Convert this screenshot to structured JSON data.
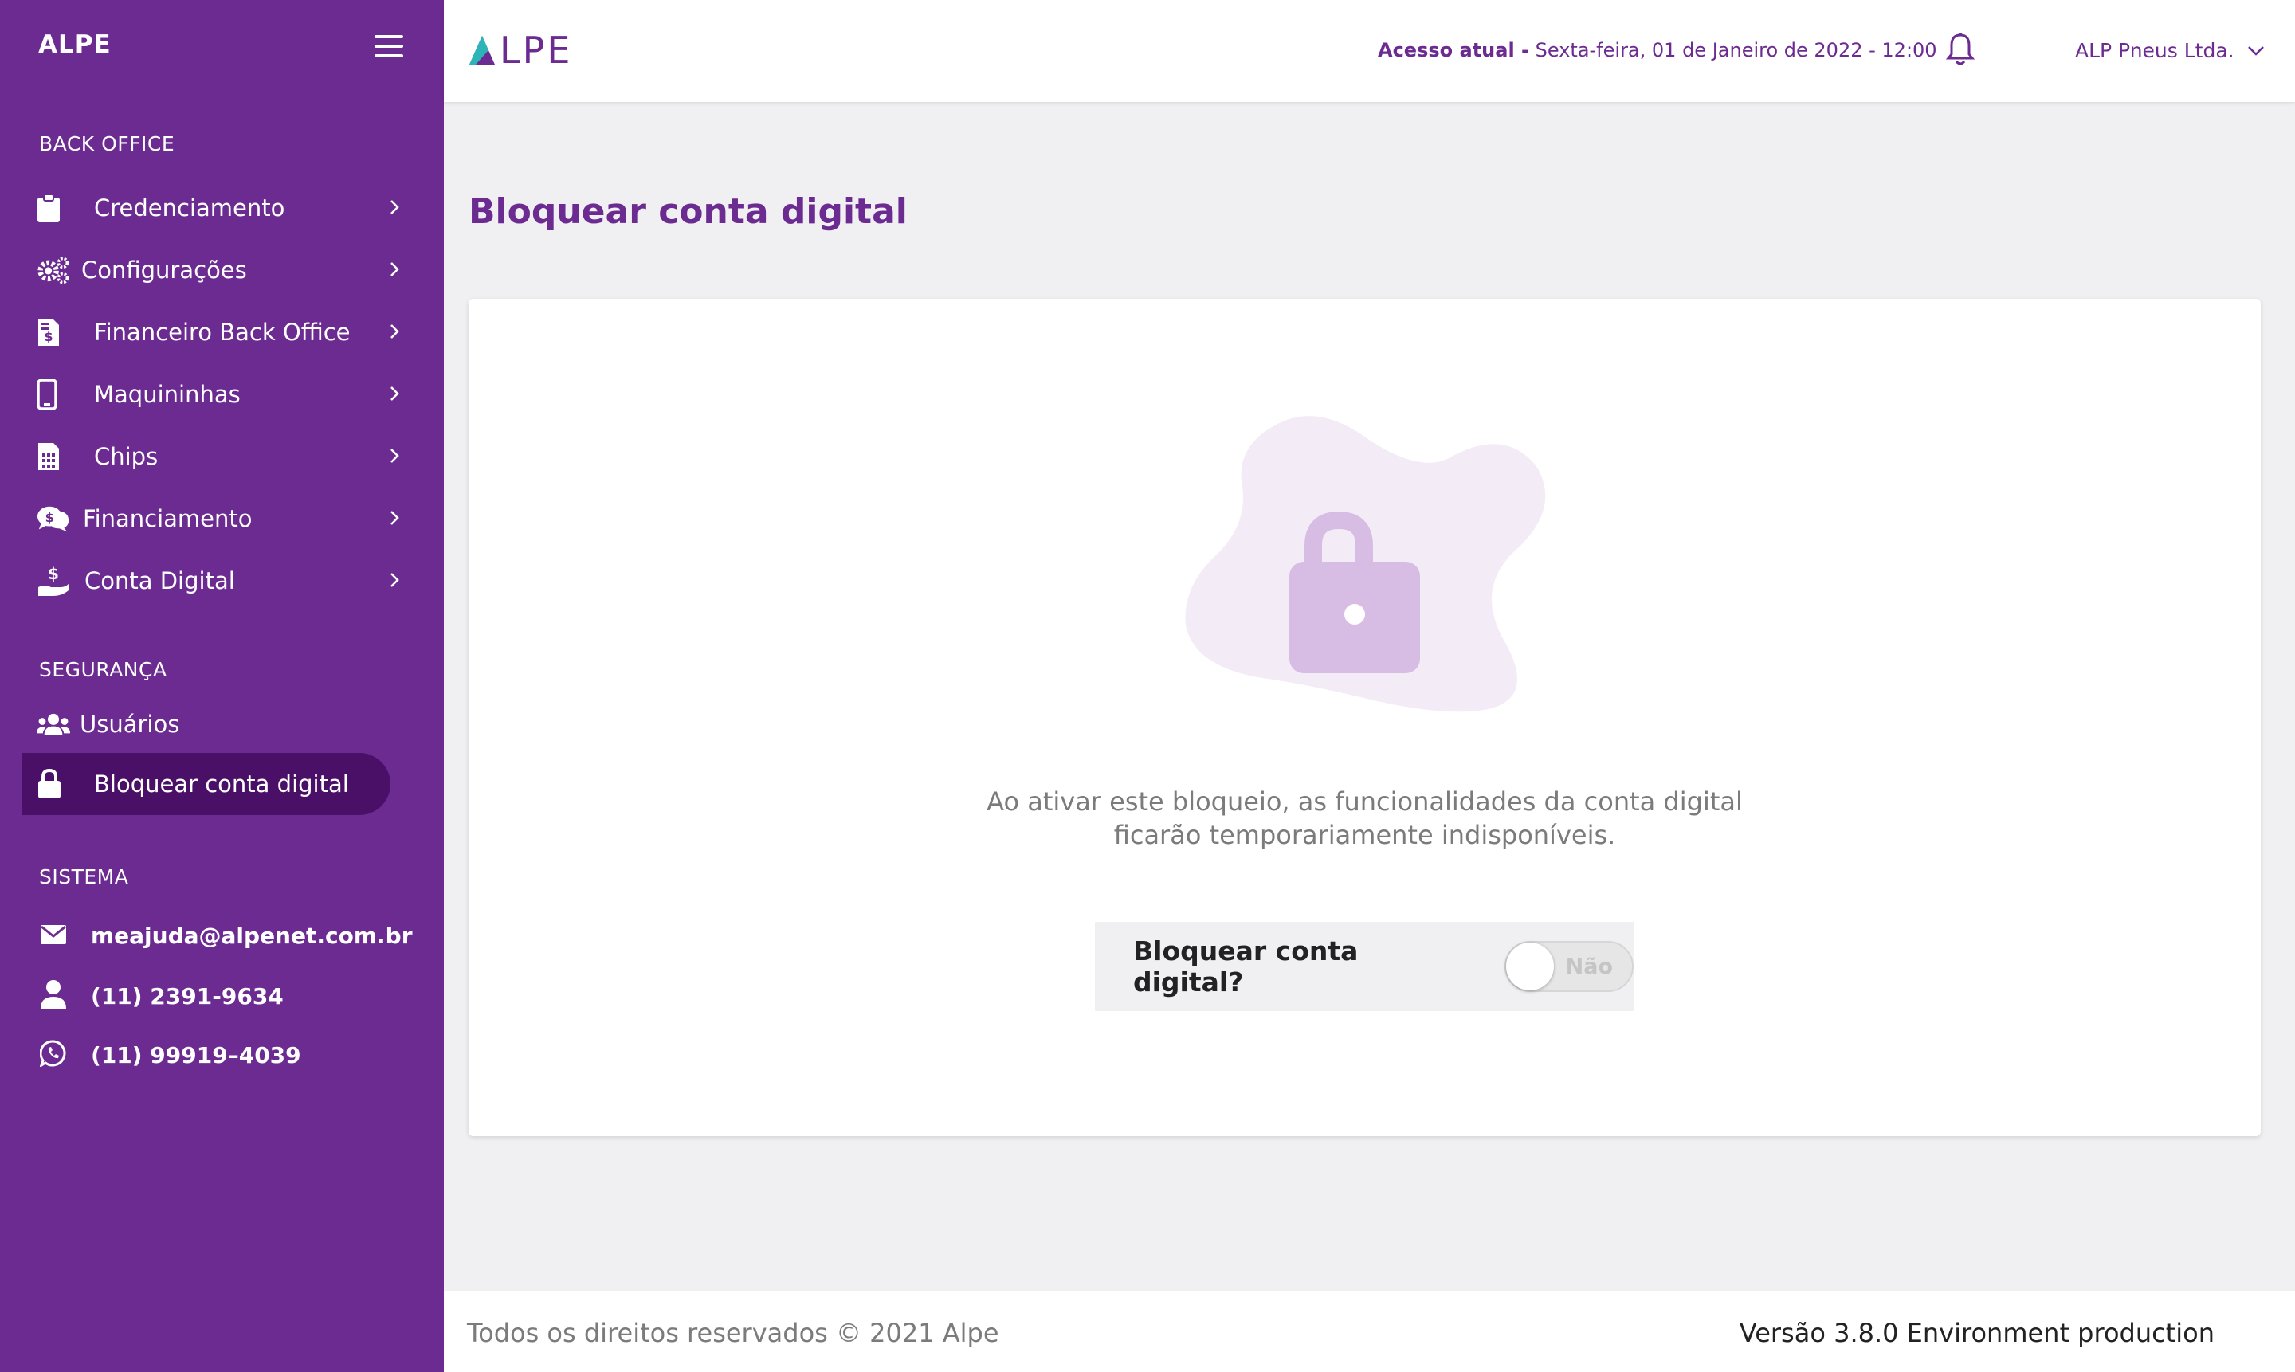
{
  "sidebar": {
    "brand": "ALPE",
    "sections": {
      "backoffice": "BACK OFFICE",
      "seguranca": "SEGURANÇA",
      "sistema": "SISTEMA"
    },
    "items": [
      {
        "label": "Credenciamento",
        "icon": "clipboard-icon"
      },
      {
        "label": "Configurações",
        "icon": "gears-icon"
      },
      {
        "label": "Financeiro Back Office",
        "icon": "invoice-dollar-icon"
      },
      {
        "label": "Maquininhas",
        "icon": "mobile-icon"
      },
      {
        "label": "Chips",
        "icon": "sim-card-icon"
      },
      {
        "label": "Financiamento",
        "icon": "comments-dollar-icon"
      },
      {
        "label": "Conta Digital",
        "icon": "hand-dollar-icon"
      }
    ],
    "security_items": [
      {
        "label": "Usuários",
        "icon": "users-icon"
      },
      {
        "label": "Bloquear conta digital",
        "icon": "lock-icon",
        "active": true
      }
    ],
    "contacts": [
      {
        "label": "meajuda@alpenet.com.br",
        "icon": "envelope-icon"
      },
      {
        "label": "(11) 2391-9634",
        "icon": "user-icon"
      },
      {
        "label": "(11) 99919–4039",
        "icon": "whatsapp-icon"
      }
    ]
  },
  "header": {
    "logo": "LPE",
    "access_label": "Acesso atual -",
    "access_value": "Sexta-feira, 01 de Janeiro  de 2022 - 12:00",
    "company": "ALP Pneus Ltda."
  },
  "main": {
    "title": "Bloquear conta digital",
    "description_line1": "Ao ativar este bloqueio, as funcionalidades da conta digital",
    "description_line2": "ficarão temporariamente indisponíveis.",
    "toggle_label": "Bloquear conta digital?",
    "toggle_state": "Não"
  },
  "footer": {
    "copyright": "Todos os direitos reservados © 2021 Alpe",
    "version": "Versão 3.8.0 Environment production"
  },
  "colors": {
    "brand": "#6c2b91",
    "active": "#4a0f66",
    "background": "#f0eff2"
  }
}
